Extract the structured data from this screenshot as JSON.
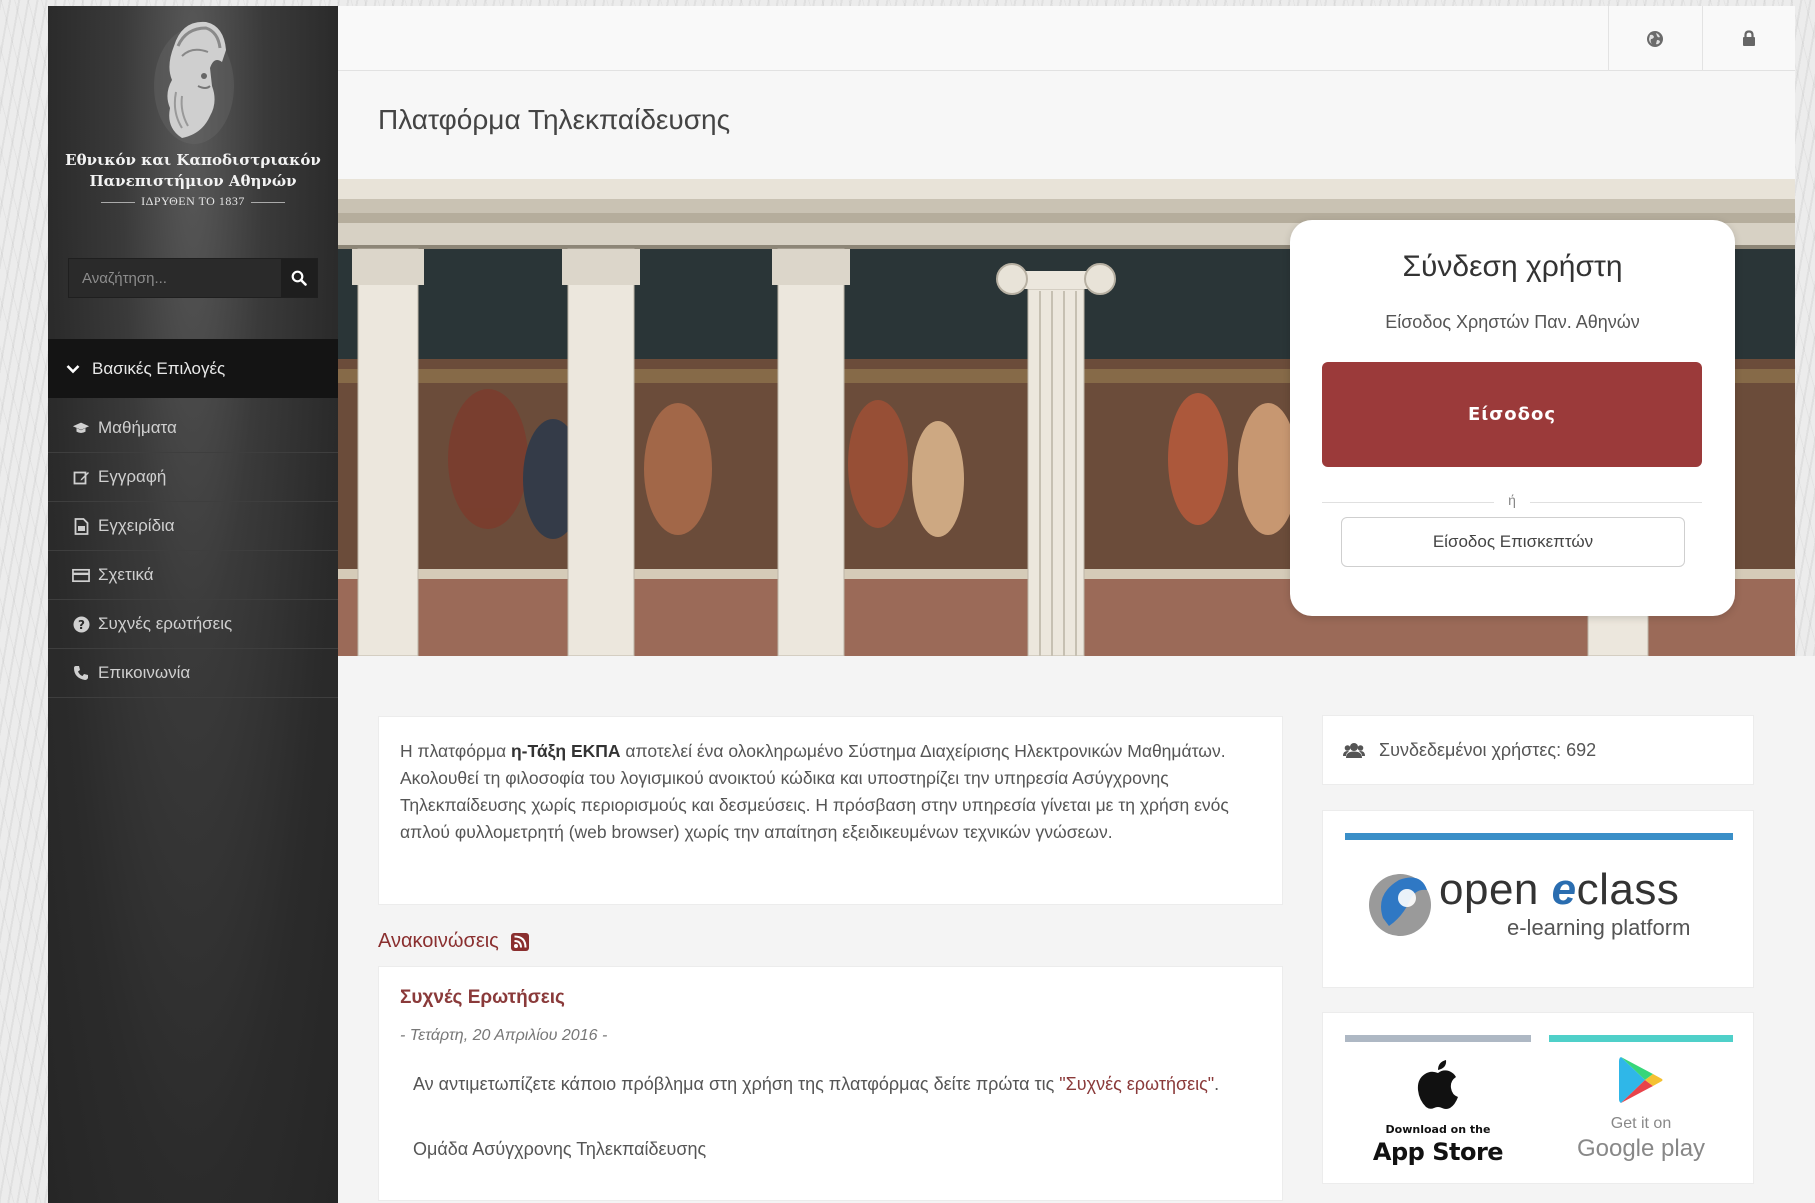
{
  "sidebar": {
    "university_line1": "Εθνικόν και Καποδιστριακόν",
    "university_line2": "Πανεπιστήμιον Αθηνών",
    "founded": "ΙΔΡΥΘΕΝ ΤΟ 1837",
    "search_placeholder": "Αναζήτηση...",
    "menu_header": "Βασικές Επιλογές",
    "items": [
      {
        "label": "Μαθήματα",
        "icon": "graduation-cap-icon"
      },
      {
        "label": "Εγγραφή",
        "icon": "edit-icon"
      },
      {
        "label": "Εγχειρίδια",
        "icon": "document-icon"
      },
      {
        "label": "Σχετικά",
        "icon": "card-icon"
      },
      {
        "label": "Συχνές ερωτήσεις",
        "icon": "question-icon"
      },
      {
        "label": "Επικοινωνία",
        "icon": "phone-icon"
      }
    ]
  },
  "topbar": {
    "language_icon": "globe-icon",
    "login_icon": "lock-icon"
  },
  "page": {
    "title": "Πλατφόρμα Τηλεκπαίδευσης"
  },
  "login": {
    "title": "Σύνδεση χρήστη",
    "subtitle": "Είσοδος Χρηστών Παν. Αθηνών",
    "login_button": "Είσοδος",
    "or": "ή",
    "guest_button": "Είσοδος Επισκεπτών"
  },
  "intro": {
    "part1": "Η πλατφόρμα ",
    "bold": "η-Τάξη ΕΚΠΑ",
    "part2": " αποτελεί ένα ολοκληρωμένο Σύστημα Διαχείρισης Ηλεκτρονικών Μαθημάτων. Ακολουθεί τη φιλοσοφία του λογισμικού ανοικτού κώδικα και υποστηρίζει την υπηρεσία Ασύγχρονης Τηλεκπαίδευσης χωρίς περιορισμούς και δεσμεύσεις. Η πρόσβαση στην υπηρεσία γίνεται με τη χρήση ενός απλού φυλλομετρητή (web browser) χωρίς την απαίτηση εξειδικευμένων τεχνικών γνώσεων."
  },
  "announcements": {
    "heading": "Ανακοινώσεις",
    "items": [
      {
        "title": "Συχνές Ερωτήσεις",
        "date": "- Τετάρτη, 20 Απριλίου 2016 -",
        "body_prefix": "Αν αντιμετωπίζετε κάποιο πρόβλημα στη χρήση της πλατφόρμας δείτε πρώτα τις ",
        "body_link": "\"Συχνές ερωτήσεις\"",
        "body_suffix": ".",
        "signature": "Ομάδα Ασύγχρονης Τηλεκπαίδευσης"
      }
    ]
  },
  "stats": {
    "online_users": "Συνδεδεμένοι χρήστες: 692"
  },
  "branding": {
    "open": "open ",
    "eclass_e": "e",
    "eclass_rest": "class",
    "tagline": "e-learning platform"
  },
  "apps": {
    "appstore_small": "Download on the",
    "appstore_big": "App Store",
    "gplay_small": "Get it on",
    "gplay_big": "Google play"
  },
  "colors": {
    "accent": "#9b3a3a",
    "sidebar": "#2b2b2b",
    "link": "#8a3a3a",
    "eclass_blue": "#3a8fc8",
    "gplay_teal": "#4fd0c9"
  }
}
